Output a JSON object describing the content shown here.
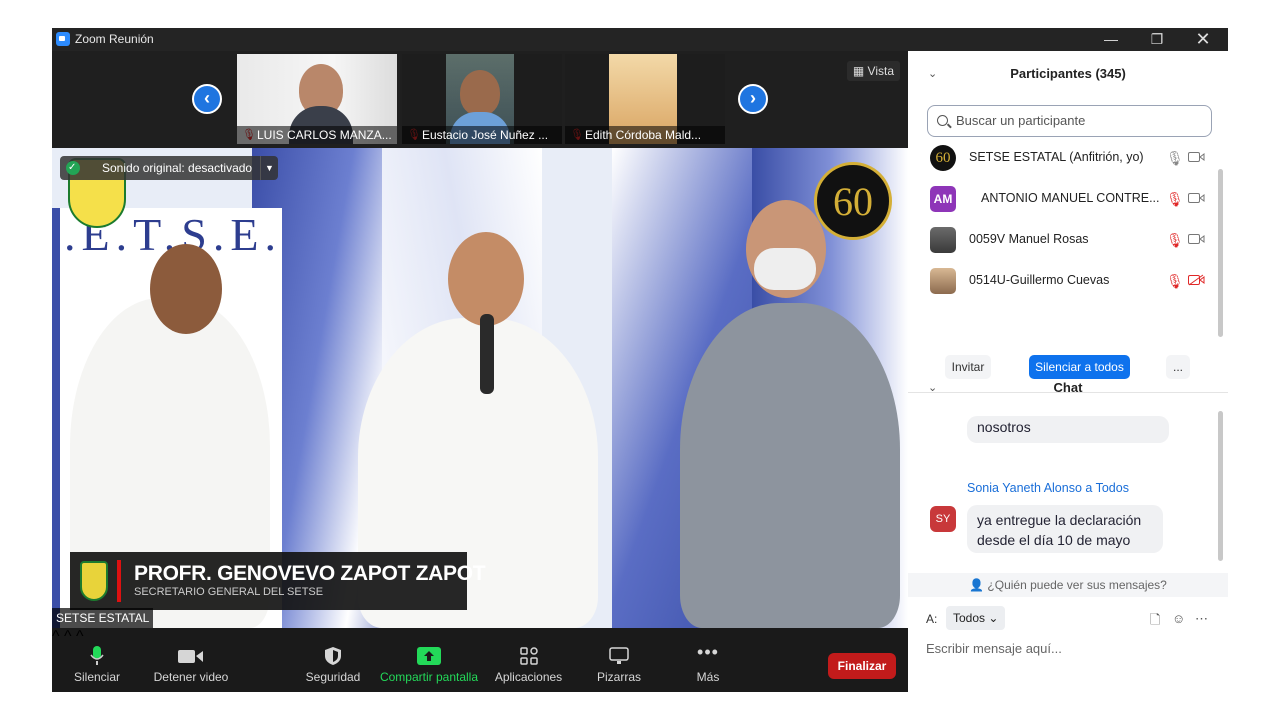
{
  "window": {
    "title": "Zoom Reunión"
  },
  "thumbnails": [
    {
      "name": "LUIS CARLOS MANZA..."
    },
    {
      "name": "Eustacio José Nuñez ..."
    },
    {
      "name": "Edith Córdoba Mald..."
    }
  ],
  "view_label": "Vista",
  "audio_label": "Sonido original: desactivado",
  "lower_third": {
    "name": "PROFR. GENOVEVO ZAPOT ZAPOT",
    "role": "SECRETARIO GENERAL DEL SETSE"
  },
  "speaker_tag": "SETSE ESTATAL",
  "banner_text": ".E.T.S.E.",
  "logo_number": "60",
  "toolbar": {
    "mute": "Silenciar",
    "stop_video": "Detener video",
    "security": "Seguridad",
    "share": "Compartir pantalla",
    "apps": "Aplicaciones",
    "whiteboards": "Pizarras",
    "more": "Más",
    "end": "Finalizar"
  },
  "participants": {
    "header": "Participantes (345)",
    "search_placeholder": "Buscar un participante",
    "list": [
      {
        "name": "SETSE ESTATAL (Anfitrión, yo)",
        "initials": "60",
        "mic": "on",
        "cam": "on"
      },
      {
        "name": "ANTONIO MANUEL CONTRE...",
        "initials": "AM",
        "mic": "muted",
        "cam": "on"
      },
      {
        "name": "0059V Manuel Rosas",
        "initials": "",
        "mic": "muted",
        "cam": "on"
      },
      {
        "name": "0514U-Guillermo Cuevas",
        "initials": "",
        "mic": "muted",
        "cam": "off"
      }
    ],
    "invite": "Invitar",
    "mute_all": "Silenciar a todos",
    "more": "..."
  },
  "chat": {
    "header": "Chat",
    "prev_message": "nosotros",
    "sender": "Sonia Yaneth Alonso a Todos",
    "sender_initials": "SY",
    "message_line1": "ya entregue la declaración",
    "message_line2": "desde el día 10 de mayo",
    "who_can_see": "¿Quién puede ver sus mensajes?",
    "to_label": "A:",
    "to_value": "Todos",
    "input_placeholder": "Escribir mensaje aquí..."
  },
  "colors": {
    "accent": "#0e72ed",
    "end": "#c21b1b",
    "share": "#23d959"
  }
}
